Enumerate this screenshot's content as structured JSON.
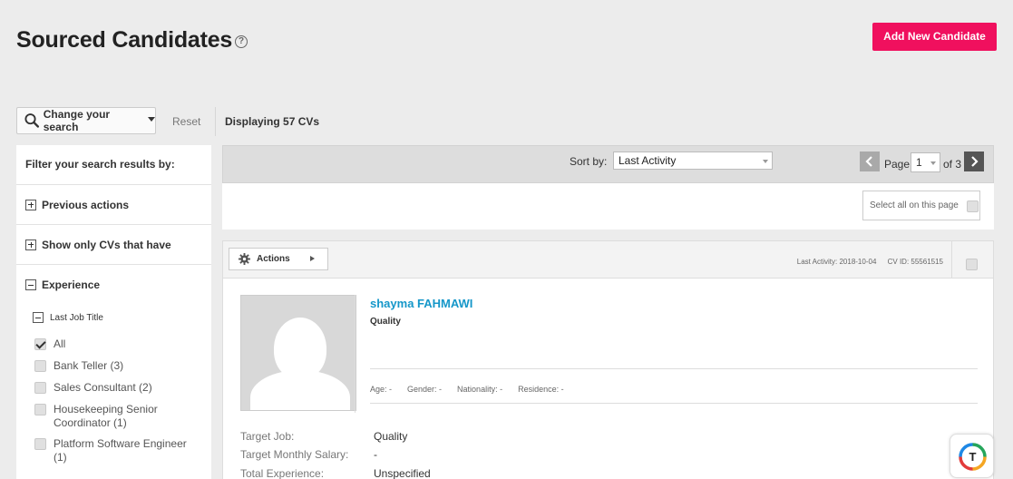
{
  "header": {
    "title": "Sourced Candidates",
    "help_glyph": "?",
    "add_button": "Add New Candidate"
  },
  "toolbar": {
    "search_button": "Change your search",
    "reset": "Reset",
    "displaying": "Displaying 57 CVs"
  },
  "sidebar": {
    "heading": "Filter your search results by:",
    "sections": [
      {
        "label": "Previous actions",
        "icon": "plus"
      },
      {
        "label": "Show only CVs that have",
        "icon": "plus"
      },
      {
        "label": "Experience",
        "icon": "minus"
      }
    ],
    "sub_label": "Last Job Title",
    "options": [
      {
        "label": "All",
        "checked": true
      },
      {
        "label": "Bank Teller (3)",
        "checked": false
      },
      {
        "label": "Sales Consultant (2)",
        "checked": false
      },
      {
        "label": "Housekeeping Senior Coordinator (1)",
        "checked": false
      },
      {
        "label": "Platform Software Engineer (1)",
        "checked": false
      }
    ]
  },
  "sortbar": {
    "sort_label": "Sort by:",
    "sort_value": "Last Activity",
    "page_label": "Page",
    "page_value": "1",
    "page_of": "of 3"
  },
  "select_all": "Select all on this page",
  "candidate": {
    "actions_label": "Actions",
    "last_activity": "Last Activity: 2018-10-04",
    "cv_id": "CV ID: 55561515",
    "name": "shayma FAHMAWI",
    "title": "Quality",
    "info": {
      "age": "Age: -",
      "gender": "Gender: -",
      "nationality": "Nationality: -",
      "residence": "Residence: -"
    },
    "details": [
      {
        "label": "Target Job:",
        "value": "Quality"
      },
      {
        "label": "Target Monthly Salary:",
        "value": "-"
      },
      {
        "label": "Total Experience:",
        "value": "Unspecified"
      }
    ]
  },
  "colors": {
    "accent": "#f0105e",
    "link": "#1597c9",
    "background": "#ececec"
  }
}
